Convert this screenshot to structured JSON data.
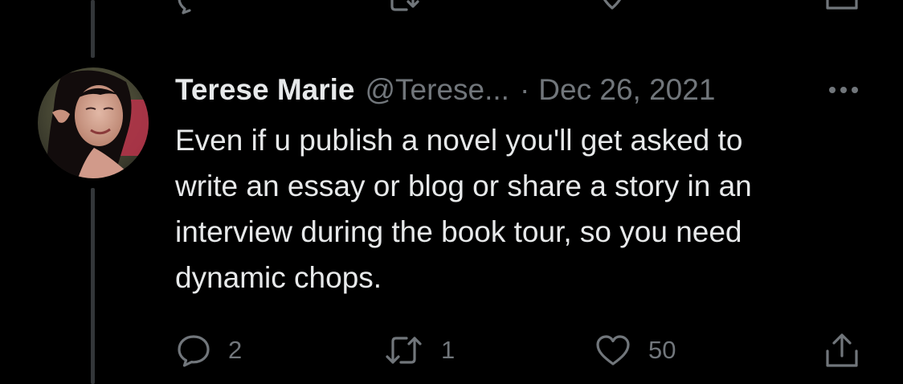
{
  "previous_tweet": {
    "reply_count": "",
    "retweet_count": "",
    "like_count": ""
  },
  "tweet": {
    "display_name": "Terese Marie",
    "handle": "@Terese...",
    "separator": "·",
    "date": "Dec 26, 2021",
    "text_lines": [
      "Even if u publish a novel you'll get asked to",
      "write an essay or blog or share a story in an",
      "interview during the book tour, so you need",
      "dynamic chops."
    ],
    "actions": {
      "reply_count": "2",
      "retweet_count": "1",
      "like_count": "50"
    }
  },
  "icons": {
    "avatar": "avatar-photo",
    "more": "more-dots-icon",
    "reply": "reply-bubble-icon",
    "retweet": "retweet-icon",
    "like": "heart-icon",
    "share": "share-upload-icon"
  },
  "colors": {
    "background": "#000000",
    "primary_text": "#e7e9ea",
    "secondary_text": "#71767b",
    "thread_line": "#333639"
  }
}
